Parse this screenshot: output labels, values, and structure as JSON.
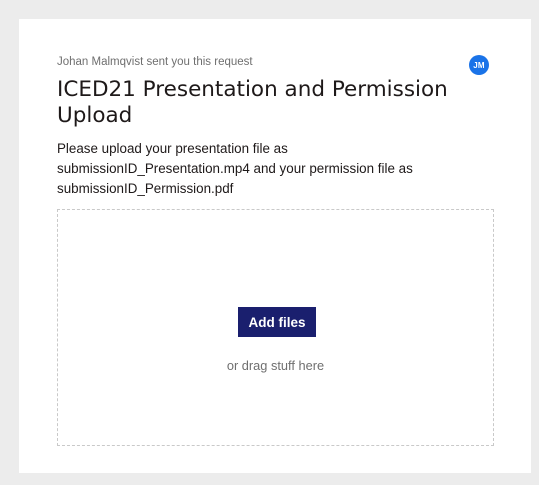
{
  "request": {
    "sender_line": "Johan Malmqvist sent you this request",
    "avatar_initials": "JM",
    "title": "ICED21 Presentation and Permission Upload",
    "description": "Please upload your presentation file as submissionID_Presentation.mp4 and your permission file as submissionID_Permission.pdf"
  },
  "dropzone": {
    "button_label": "Add files",
    "hint": "or drag stuff here"
  },
  "colors": {
    "avatar_bg": "#1a73e8",
    "button_bg": "#1a1f6e",
    "page_bg": "#ececec"
  }
}
